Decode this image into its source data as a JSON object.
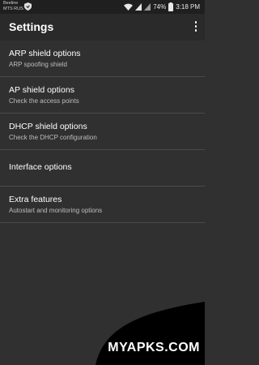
{
  "status_bar": {
    "carrier_1": "Beeline",
    "carrier_2": "MTS RUS",
    "battery": "74%",
    "time": "3:18 PM",
    "icons": [
      "shield-icon",
      "wifi-icon",
      "signal-icon",
      "signal-icon",
      "battery-icon"
    ]
  },
  "app_bar": {
    "title": "Settings",
    "overflow_icon": "more-vert-icon"
  },
  "settings": {
    "items": [
      {
        "title": "ARP shield options",
        "summary": "ARP spoofing shield"
      },
      {
        "title": "AP shield options",
        "summary": "Check the access points"
      },
      {
        "title": "DHCP shield options",
        "summary": "Check the DHCP configuration"
      },
      {
        "title": "Interface options",
        "summary": ""
      },
      {
        "title": "Extra features",
        "summary": "Autostart and monitoring options"
      }
    ]
  },
  "watermark": {
    "text": "MYAPKS.COM"
  },
  "colors": {
    "background": "#303030",
    "app_bar": "#2a2a2a",
    "status_bar": "#1f1f1f",
    "divider": "#4a4a4a",
    "summary_text": "#bdbdbd"
  }
}
